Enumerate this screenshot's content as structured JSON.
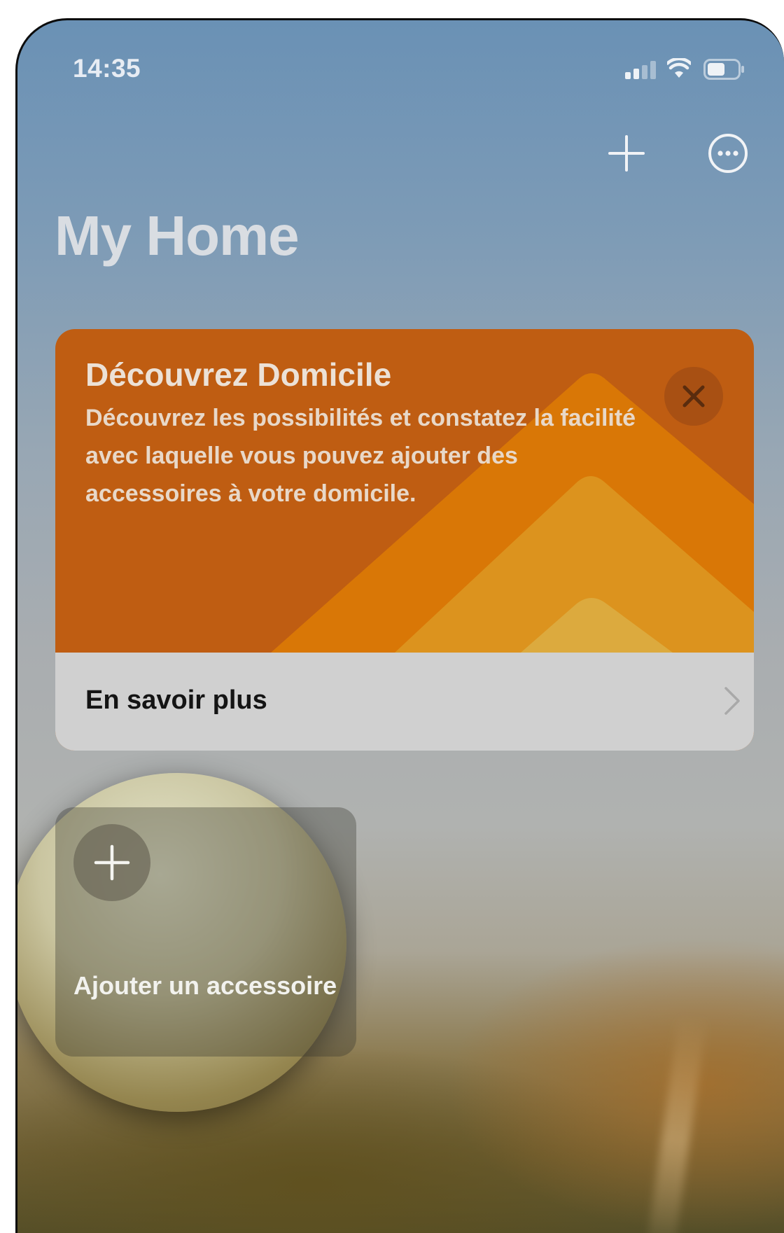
{
  "status_bar": {
    "time": "14:35",
    "icons": [
      "signal-icon",
      "wifi-icon",
      "battery-icon"
    ]
  },
  "toolbar": {
    "add_icon": "plus-icon",
    "more_icon": "ellipsis-circle-icon"
  },
  "page": {
    "title": "My Home"
  },
  "discover_card": {
    "title": "Découvrez Domicile",
    "body": "Découvrez les possibilités et constatez la facilité avec laquelle vous pouvez ajouter des accessoires à votre domicile.",
    "close_icon": "close-icon",
    "footer_label": "En savoir plus",
    "footer_icon": "chevron-right-icon",
    "colors": {
      "background": "#bf5d12",
      "stripe_1": "#d97706",
      "stripe_2": "#dc931e",
      "stripe_3": "#dcaa3e",
      "footer": "#d0d0d0"
    }
  },
  "add_accessory_tile": {
    "icon": "plus-icon",
    "label": "Ajouter un accessoire"
  }
}
